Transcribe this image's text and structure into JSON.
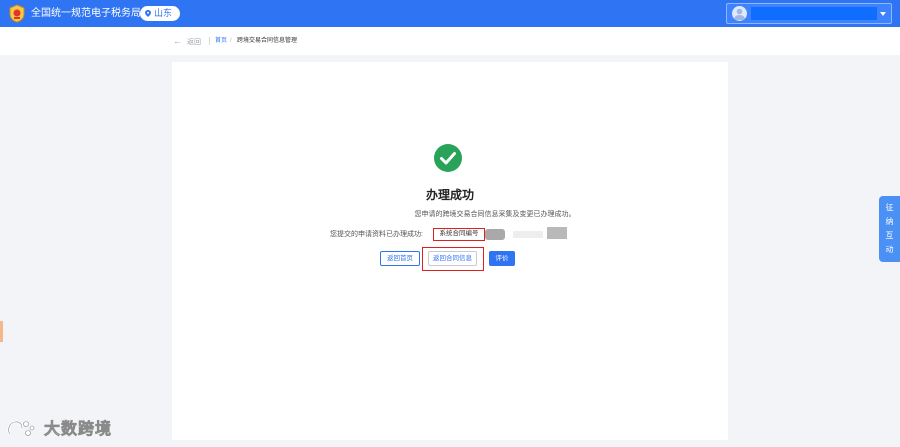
{
  "header": {
    "brand": "全国统一规范电子税务局",
    "region": "山东",
    "colors": {
      "primary": "#2f74f3"
    }
  },
  "breadcrumb": {
    "back_label": "返回",
    "back_icon": "arrow-left-icon",
    "home": "首页",
    "separator": "/",
    "current": "跨境交易合同信息管理"
  },
  "result": {
    "icon": "check-circle-icon",
    "title": "办理成功",
    "message": "您申请的跨境交易合同信息采集及变更已办理成功。",
    "submitted_label": "您提交的申请资料已办理成功:",
    "contract_label": "系统合同编号",
    "colors": {
      "success": "#2aa35a",
      "highlight": "#e0201f"
    }
  },
  "buttons": {
    "home": "返回首页",
    "manage": "返回合同信息",
    "rate": "评价"
  },
  "side_tab": {
    "label": [
      "征",
      "纳",
      "互",
      "动"
    ]
  },
  "watermark": {
    "text": "大数跨境"
  }
}
